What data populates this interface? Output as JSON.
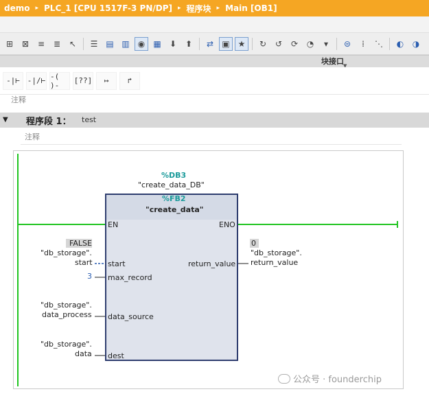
{
  "breadcrumb": {
    "items": [
      "demo",
      "PLC_1 [CPU 1517F-3 PN/DP]",
      "程序块",
      "Main [OB1]"
    ],
    "separator": "▸"
  },
  "toolbar": {
    "icons": [
      "insert-network-icon",
      "delete-network-icon",
      "insert-row-icon",
      "append-row-icon",
      "cursor-icon",
      "sep",
      "absolute-symbolic-icon",
      "network-view-icon",
      "show-comments-icon",
      "favorites-icon",
      "monitor-list-icon",
      "download-icon",
      "upload-icon",
      "sep",
      "compare-icon",
      "open-all-icon",
      "sep",
      "goto-icon",
      "goto-back-icon",
      "goto-next-icon",
      "sep",
      "monitoring-icon",
      "more-icon"
    ]
  },
  "interface_bar": {
    "label": "块接口"
  },
  "ladder_toolbar": {
    "buttons": [
      {
        "name": "normally-open-contact",
        "glyph": "-|⊢"
      },
      {
        "name": "normally-closed-contact",
        "glyph": "-|/⊢"
      },
      {
        "name": "coil",
        "glyph": "-( )-"
      },
      {
        "name": "empty-box",
        "glyph": "[??]"
      },
      {
        "name": "open-branch",
        "glyph": "↦"
      },
      {
        "name": "close-branch",
        "glyph": "↱"
      }
    ]
  },
  "block_comment": "注释",
  "network": {
    "title": "程序段 1：",
    "name": "test",
    "comment": "注释"
  },
  "fb": {
    "instance_db": "%DB3",
    "instance_db_name": "\"create_data_DB\"",
    "address": "%FB2",
    "name": "\"create_data\"",
    "en": "EN",
    "eno": "ENO",
    "inputs": [
      {
        "pin": "start",
        "operand_line1": "\"db_storage\".",
        "operand_line2": "start",
        "value": "FALSE"
      },
      {
        "pin": "max_record",
        "operand": "3"
      },
      {
        "pin": "data_source",
        "operand_line1": "\"db_storage\".",
        "operand_line2": "data_process"
      },
      {
        "pin": "dest",
        "operand_line1": "\"db_storage\".",
        "operand_line2": "data"
      }
    ],
    "outputs": [
      {
        "pin": "return_value",
        "value": "0",
        "operand_line1": "\"db_storage\".",
        "operand_line2": "return_value"
      }
    ]
  },
  "watermark": "公众号 · founderchip",
  "colors": {
    "titlebar": "#f5a623",
    "power_rail": "#21c421",
    "fb_border": "#2d3c6e",
    "teal_label": "#1a9a9a",
    "blue_value": "#2a5db0"
  }
}
